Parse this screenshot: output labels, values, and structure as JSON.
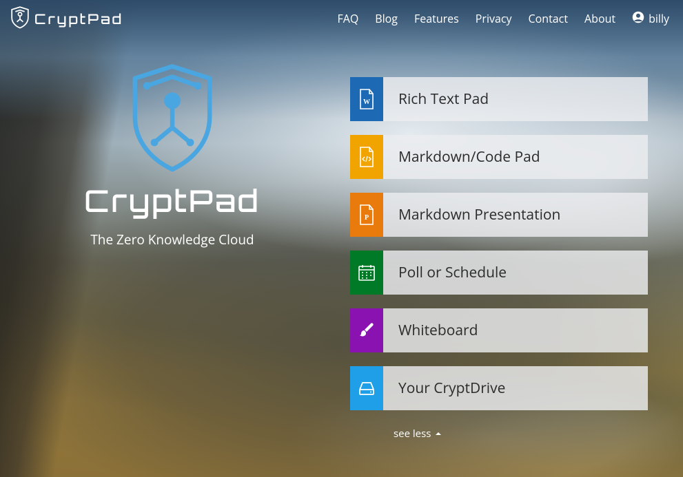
{
  "brand": {
    "name": "CryptPad",
    "tagline": "The Zero Knowledge Cloud"
  },
  "nav": {
    "links": [
      "FAQ",
      "Blog",
      "Features",
      "Privacy",
      "Contact",
      "About"
    ],
    "user": "billy"
  },
  "apps": [
    {
      "label": "Rich Text Pad",
      "color": "c-blue",
      "icon": "doc-w"
    },
    {
      "label": "Markdown/Code Pad",
      "color": "c-yellow",
      "icon": "doc-code"
    },
    {
      "label": "Markdown Presentation",
      "color": "c-orange",
      "icon": "doc-p"
    },
    {
      "label": "Poll or Schedule",
      "color": "c-green",
      "icon": "calendar"
    },
    {
      "label": "Whiteboard",
      "color": "c-purple",
      "icon": "brush"
    },
    {
      "label": "Your CryptDrive",
      "color": "c-sky",
      "icon": "drive"
    }
  ],
  "toggle": {
    "label": "see less"
  }
}
